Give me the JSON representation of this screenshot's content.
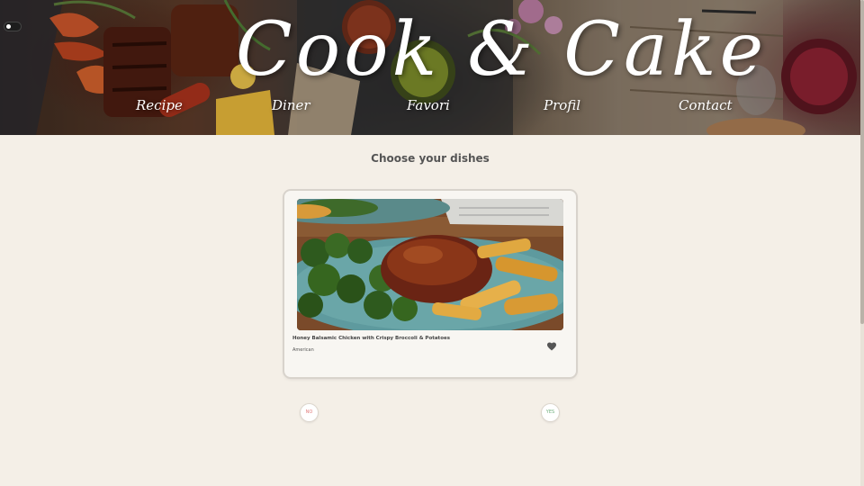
{
  "header": {
    "brand": "Cook & Cake",
    "nav": [
      {
        "label": "Recipe"
      },
      {
        "label": "Diner"
      },
      {
        "label": "Favori"
      },
      {
        "label": "Profil"
      },
      {
        "label": "Contact"
      }
    ]
  },
  "main": {
    "title": "Choose your dishes",
    "card": {
      "dish_name": "Honey Balsamic Chicken with Crispy Broccoli & Potatoes",
      "cuisine": "American"
    },
    "no_label": "NO",
    "yes_label": "YES"
  },
  "colors": {
    "background": "#f4efe7",
    "no_accent": "#e07a7a",
    "yes_accent": "#6fae7c"
  },
  "icons": {
    "theme_toggle": "toggle-switch-icon",
    "favorite": "heart-icon"
  }
}
